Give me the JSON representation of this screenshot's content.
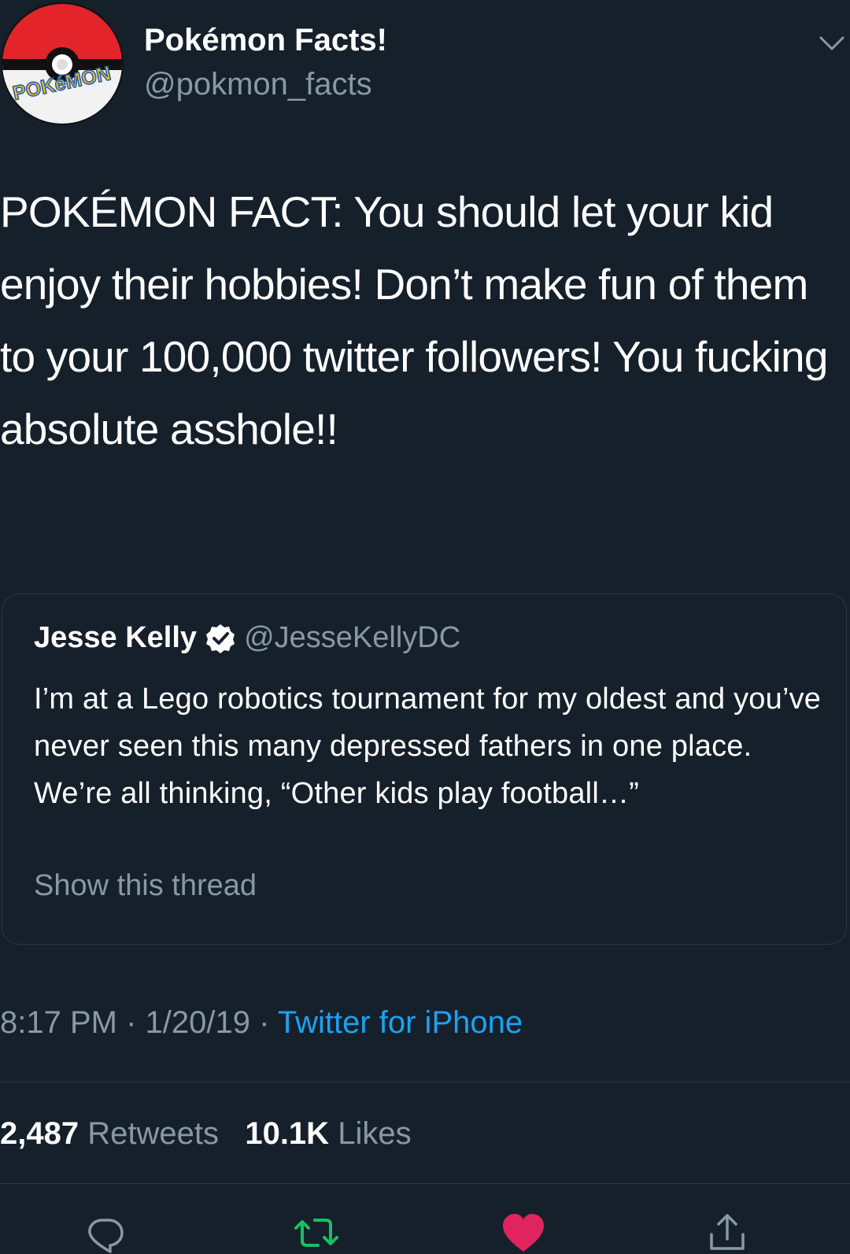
{
  "author": {
    "name": "Pokémon Facts!",
    "handle": "@pokmon_facts",
    "avatar_text": "POKéMON",
    "avatar_icon": "pokeball-logo-icon"
  },
  "tweet": {
    "text": "POKÉMON FACT: You should let your kid enjoy their hobbies! Don’t make fun of them to your 100,000 twitter followers! You fucking absolute asshole!!"
  },
  "quoted": {
    "name": "Jesse Kelly",
    "verified_icon": "verified-badge-icon",
    "handle": "@JesseKellyDC",
    "text": "I’m at a Lego robotics tournament for my oldest and you’ve never seen this many depressed fathers in one place. We’re all thinking, “Other kids play football…”",
    "show_thread": "Show this thread"
  },
  "meta": {
    "time": "8:17 PM",
    "separator": "·",
    "date": "1/20/19",
    "source": "Twitter for iPhone"
  },
  "stats": {
    "retweets_count": "2,487",
    "retweets_label": "Retweets",
    "likes_count": "10.1K",
    "likes_label": "Likes"
  },
  "actions": {
    "reply_icon": "reply-icon",
    "retweet_icon": "retweet-icon",
    "like_icon": "heart-icon",
    "share_icon": "share-icon"
  },
  "colors": {
    "background": "#15202b",
    "text": "#ffffff",
    "secondary": "#8899a6",
    "link": "#1da1f2",
    "retweet": "#17bf63",
    "like": "#e0245e"
  }
}
